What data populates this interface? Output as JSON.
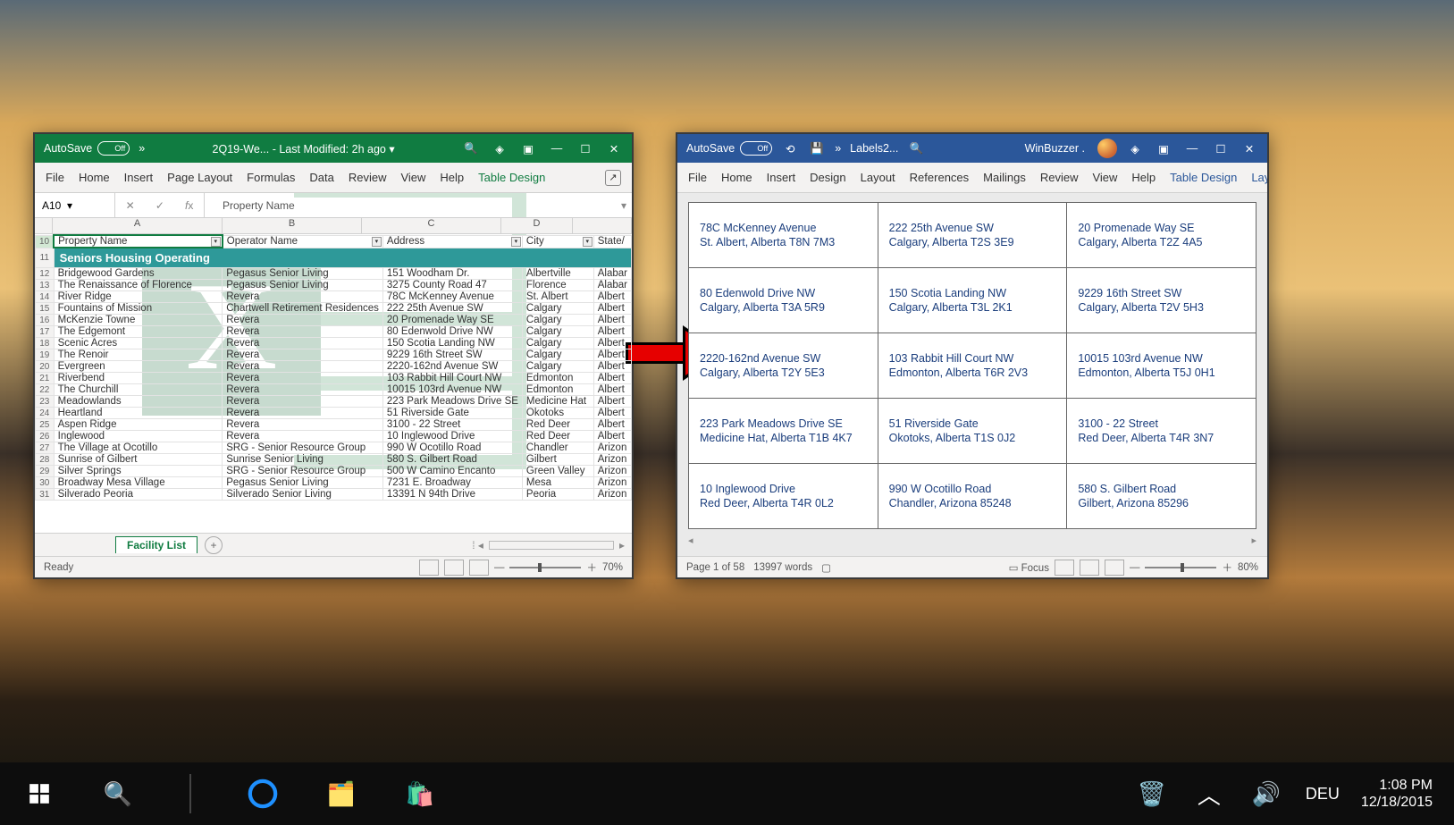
{
  "taskbar": {
    "lang": "DEU",
    "time": "1:08 PM",
    "date": "12/18/2015"
  },
  "excel": {
    "autosave_label": "AutoSave",
    "autosave_state": "Off",
    "title": "2Q19-We... - Last Modified: 2h ago ▾",
    "ribbon": [
      "File",
      "Home",
      "Insert",
      "Page Layout",
      "Formulas",
      "Data",
      "Review",
      "View",
      "Help",
      "Table Design"
    ],
    "namebox": "A10",
    "formula": "Property Name",
    "columns": [
      "A",
      "B",
      "C",
      "D"
    ],
    "headers": [
      "Property Name",
      "Operator Name",
      "Address",
      "City",
      "State/"
    ],
    "section": "Seniors Housing Operating",
    "rows": [
      {
        "n": 12,
        "a": "Bridgewood Gardens",
        "b": "Pegasus Senior Living",
        "c": "151 Woodham Dr.",
        "d": "Albertville",
        "e": "Alabar"
      },
      {
        "n": 13,
        "a": "The Renaissance of Florence",
        "b": "Pegasus Senior Living",
        "c": "3275 County Road 47",
        "d": "Florence",
        "e": "Alabar"
      },
      {
        "n": 14,
        "a": "River Ridge",
        "b": "Revera",
        "c": "78C McKenney Avenue",
        "d": "St. Albert",
        "e": "Albert"
      },
      {
        "n": 15,
        "a": "Fountains of Mission",
        "b": "Chartwell Retirement Residences",
        "c": "222 25th Avenue SW",
        "d": "Calgary",
        "e": "Albert"
      },
      {
        "n": 16,
        "a": "McKenzie Towne",
        "b": "Revera",
        "c": "20 Promenade Way SE",
        "d": "Calgary",
        "e": "Albert"
      },
      {
        "n": 17,
        "a": "The Edgemont",
        "b": "Revera",
        "c": "80 Edenwold Drive NW",
        "d": "Calgary",
        "e": "Albert"
      },
      {
        "n": 18,
        "a": "Scenic Acres",
        "b": "Revera",
        "c": "150 Scotia Landing NW",
        "d": "Calgary",
        "e": "Albert"
      },
      {
        "n": 19,
        "a": "The Renoir",
        "b": "Revera",
        "c": "9229 16th Street SW",
        "d": "Calgary",
        "e": "Albert"
      },
      {
        "n": 20,
        "a": "Evergreen",
        "b": "Revera",
        "c": "2220-162nd Avenue SW",
        "d": "Calgary",
        "e": "Albert"
      },
      {
        "n": 21,
        "a": "Riverbend",
        "b": "Revera",
        "c": "103 Rabbit Hill Court NW",
        "d": "Edmonton",
        "e": "Albert"
      },
      {
        "n": 22,
        "a": "The Churchill",
        "b": "Revera",
        "c": "10015 103rd Avenue NW",
        "d": "Edmonton",
        "e": "Albert"
      },
      {
        "n": 23,
        "a": "Meadowlands",
        "b": "Revera",
        "c": "223 Park Meadows Drive SE",
        "d": "Medicine Hat",
        "e": "Albert"
      },
      {
        "n": 24,
        "a": "Heartland",
        "b": "Revera",
        "c": "51 Riverside Gate",
        "d": "Okotoks",
        "e": "Albert"
      },
      {
        "n": 25,
        "a": "Aspen Ridge",
        "b": "Revera",
        "c": "3100 - 22 Street",
        "d": "Red Deer",
        "e": "Albert"
      },
      {
        "n": 26,
        "a": "Inglewood",
        "b": "Revera",
        "c": "10 Inglewood Drive",
        "d": "Red Deer",
        "e": "Albert"
      },
      {
        "n": 27,
        "a": "The Village at Ocotillo",
        "b": "SRG - Senior Resource Group",
        "c": "990 W Ocotillo Road",
        "d": "Chandler",
        "e": "Arizon"
      },
      {
        "n": 28,
        "a": "Sunrise of Gilbert",
        "b": "Sunrise Senior Living",
        "c": "580 S. Gilbert Road",
        "d": "Gilbert",
        "e": "Arizon"
      },
      {
        "n": 29,
        "a": "Silver Springs",
        "b": "SRG - Senior Resource Group",
        "c": "500 W Camino Encanto",
        "d": "Green Valley",
        "e": "Arizon"
      },
      {
        "n": 30,
        "a": "Broadway Mesa Village",
        "b": "Pegasus Senior Living",
        "c": "7231 E. Broadway",
        "d": "Mesa",
        "e": "Arizon"
      },
      {
        "n": 31,
        "a": "Silverado Peoria",
        "b": "Silverado Senior Living",
        "c": "13391 N 94th Drive",
        "d": "Peoria",
        "e": "Arizon"
      }
    ],
    "sheet": "Facility List",
    "status": "Ready",
    "zoom": "70%"
  },
  "word": {
    "autosave_label": "AutoSave",
    "autosave_state": "Off",
    "title": "Labels2...",
    "brand": "WinBuzzer .",
    "ribbon": [
      "File",
      "Home",
      "Insert",
      "Design",
      "Layout",
      "References",
      "Mailings",
      "Review",
      "View",
      "Help",
      "Table Design",
      "Layout"
    ],
    "labels": [
      [
        {
          "l1": "78C McKenney Avenue",
          "l2": "St. Albert, Alberta T8N 7M3"
        },
        {
          "l1": "222 25th Avenue SW",
          "l2": "Calgary, Alberta T2S 3E9"
        },
        {
          "l1": "20 Promenade Way SE",
          "l2": "Calgary, Alberta T2Z 4A5"
        }
      ],
      [
        {
          "l1": "80 Edenwold Drive NW",
          "l2": "Calgary, Alberta T3A 5R9"
        },
        {
          "l1": "150 Scotia Landing NW",
          "l2": "Calgary, Alberta T3L 2K1"
        },
        {
          "l1": "9229 16th Street SW",
          "l2": "Calgary, Alberta T2V 5H3"
        }
      ],
      [
        {
          "l1": "2220-162nd Avenue SW",
          "l2": "Calgary, Alberta T2Y 5E3"
        },
        {
          "l1": "103 Rabbit Hill Court NW",
          "l2": "Edmonton, Alberta T6R 2V3"
        },
        {
          "l1": "10015 103rd Avenue NW",
          "l2": "Edmonton, Alberta T5J 0H1"
        }
      ],
      [
        {
          "l1": "223 Park Meadows Drive SE",
          "l2": "Medicine Hat, Alberta T1B 4K7"
        },
        {
          "l1": "51 Riverside Gate",
          "l2": "Okotoks, Alberta T1S 0J2"
        },
        {
          "l1": "3100 - 22 Street",
          "l2": "Red Deer, Alberta T4R 3N7"
        }
      ],
      [
        {
          "l1": "10 Inglewood Drive",
          "l2": "Red Deer, Alberta T4R 0L2"
        },
        {
          "l1": "990 W Ocotillo Road",
          "l2": "Chandler, Arizona 85248"
        },
        {
          "l1": "580 S. Gilbert Road",
          "l2": "Gilbert, Arizona 85296"
        }
      ]
    ],
    "status_page": "Page 1 of 58",
    "status_words": "13997 words",
    "focus": "Focus",
    "zoom": "80%"
  }
}
